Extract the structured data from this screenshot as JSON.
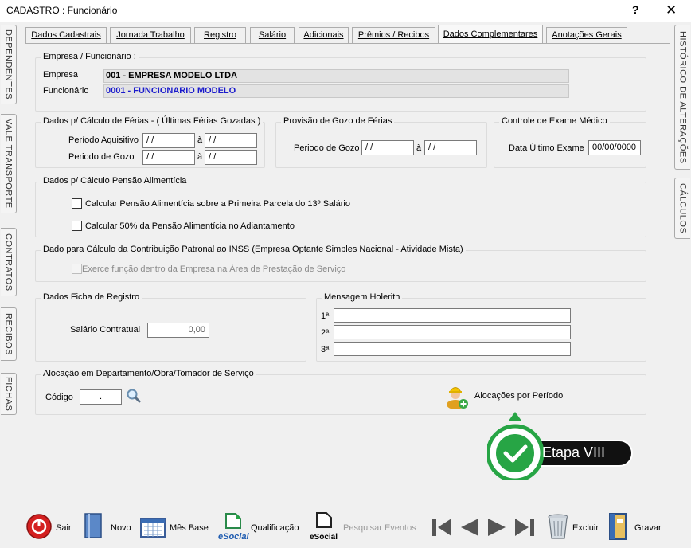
{
  "window": {
    "title": "CADASTRO : Funcionário",
    "help": "?",
    "close": "✕"
  },
  "left_tabs": [
    "DEPENDENTES",
    "VALE TRANSPORTE",
    "CONTRATOS",
    "RECIBOS",
    "FICHAS"
  ],
  "right_tabs": [
    "HISTÓRICO DE ALTERAÇÕES",
    "CÁLCULOS"
  ],
  "tabs": [
    {
      "label": "Dados Cadastrais"
    },
    {
      "label": "Jornada Trabalho"
    },
    {
      "label": "Registro"
    },
    {
      "label": "Salário"
    },
    {
      "label": "Adicionais"
    },
    {
      "label": "Prêmios / Recibos"
    },
    {
      "label": "Dados Complementares",
      "active": true
    },
    {
      "label": "Anotações Gerais"
    }
  ],
  "empresa_group": {
    "legend": "Empresa / Funcionário :",
    "empresa_label": "Empresa",
    "empresa_value": "001 - EMPRESA MODELO LTDA",
    "funcionario_label": "Funcionário",
    "funcionario_value": "0001 - FUNCIONARIO MODELO",
    "funcionario_color": "#1a1acc"
  },
  "ferias": {
    "legend": "Dados p/ Cálculo de Férias - ( Últimas Férias Gozadas )",
    "aquisitivo_label": "Período Aquisitivo",
    "gozo_label": "Periodo de Gozo",
    "aquisitivo_from": " / /",
    "aquisitivo_to": " / /",
    "gozo_from": " / /",
    "gozo_to": " / /",
    "sep": "à"
  },
  "provisao": {
    "legend": "Provisão de Gozo de Férias",
    "label": "Periodo de Gozo",
    "from": " / /",
    "to": " / /",
    "sep": "à"
  },
  "exame": {
    "legend": "Controle de Exame Médico",
    "label": "Data Último Exame",
    "value": "00/00/0000"
  },
  "pensao": {
    "legend": "Dados p/ Cálculo Pensão Alimentícia",
    "opt1": "Calcular Pensão Alimentícia sobre a Primeira Parcela do 13º Salário",
    "opt2": "Calcular 50% da Pensão Alimentícia no Adiantamento"
  },
  "inss": {
    "legend": "Dado para Cálculo da Contribuição Patronal ao INSS (Empresa Optante Simples Nacional - Atividade Mista)",
    "opt": "Exerce função dentro da Empresa na Área de Prestação de Serviço"
  },
  "ficha": {
    "legend": "Dados Ficha de Registro",
    "salario_label": "Salário Contratual",
    "salario_value": "0,00"
  },
  "holerith": {
    "legend": "Mensagem Holerith",
    "lines": [
      "1ª",
      "2ª",
      "3ª"
    ]
  },
  "alocacao": {
    "legend": "Alocação em Departamento/Obra/Tomador de Serviço",
    "codigo_label": "Código",
    "codigo_value": ".",
    "periodo_label": "Alocações por Período"
  },
  "badge": {
    "label": "Etapa VIII",
    "green": "#27a545"
  },
  "toolbar": {
    "sair": "Sair",
    "novo": "Novo",
    "mes_base": "Mês Base",
    "esocial": "eSocial",
    "qualificacao": "Qualificação",
    "pesquisar": "Pesquisar Eventos",
    "excluir": "Excluir",
    "gravar": "Gravar"
  }
}
